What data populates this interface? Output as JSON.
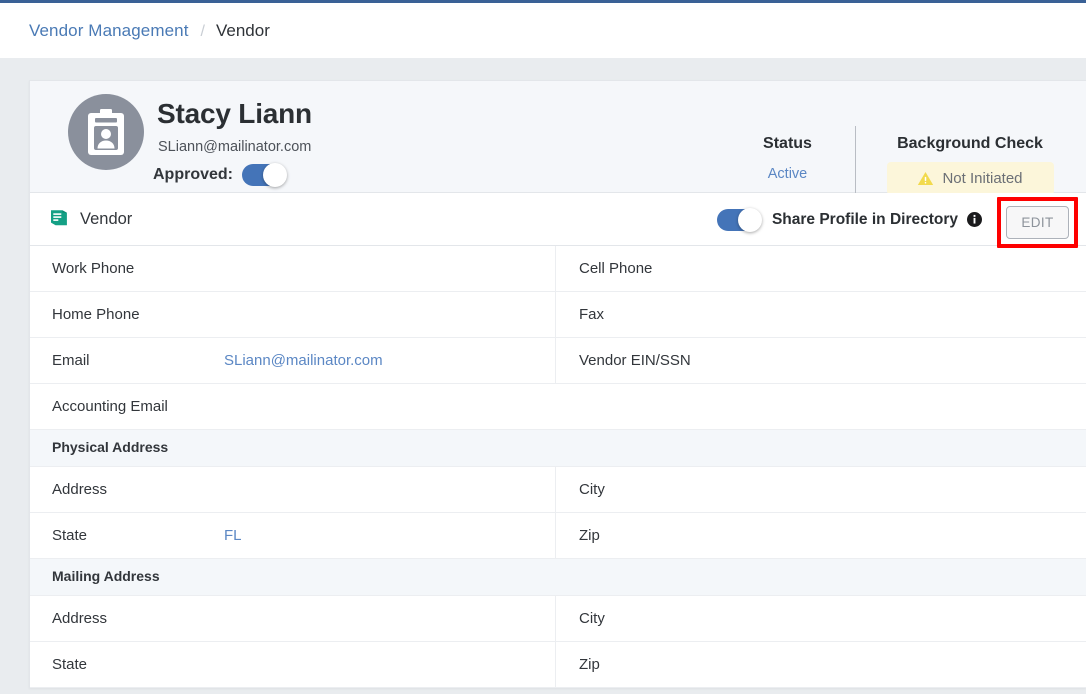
{
  "breadcrumb": {
    "root": "Vendor Management",
    "separator": "/",
    "current": "Vendor"
  },
  "profile": {
    "avatar_icon": "id-badge-icon",
    "name": "Stacy Liann",
    "email": "SLiann@mailinator.com",
    "approved_label": "Approved:",
    "approved_on": true,
    "status_title": "Status",
    "status_value": "Active",
    "background_title": "Background Check",
    "background_badge": "Not Initiated",
    "background_badge_icon": "warning-triangle-icon"
  },
  "tabbar": {
    "tab_icon": "book-icon",
    "tab_label": "Vendor",
    "share_toggle_on": true,
    "share_label": "Share Profile in Directory",
    "share_info_icon": "info-circle-icon",
    "edit_label": "EDIT",
    "edit_highlighted": true
  },
  "details": [
    {
      "kind": "row",
      "left_label": "Work Phone",
      "left_value": "",
      "right_label": "Cell Phone",
      "right_value": "",
      "right_border": true
    },
    {
      "kind": "row",
      "left_label": "Home Phone",
      "left_value": "",
      "right_label": "Fax",
      "right_value": "",
      "right_border": true
    },
    {
      "kind": "row",
      "left_label": "Email",
      "left_value": "SLiann@mailinator.com",
      "right_label": "Vendor EIN/SSN",
      "right_value": "",
      "right_border": true
    },
    {
      "kind": "row",
      "left_label": "Accounting Email",
      "left_value": "",
      "right_label": "",
      "right_value": "",
      "right_border": false
    },
    {
      "kind": "section",
      "title": "Physical Address"
    },
    {
      "kind": "row",
      "left_label": "Address",
      "left_value": "",
      "right_label": "City",
      "right_value": "",
      "right_border": true
    },
    {
      "kind": "row",
      "left_label": "State",
      "left_value": "FL",
      "right_label": "Zip",
      "right_value": "",
      "right_border": true
    },
    {
      "kind": "section",
      "title": "Mailing Address"
    },
    {
      "kind": "row",
      "left_label": "Address",
      "left_value": "",
      "right_label": "City",
      "right_value": "",
      "right_border": true
    },
    {
      "kind": "row",
      "left_label": "State",
      "left_value": "",
      "right_label": "Zip",
      "right_value": "",
      "right_border": true
    }
  ],
  "colors": {
    "top_bar": "#3a6196",
    "link": "#4a7ab5",
    "toggle_on": "#4474b8",
    "tab_icon": "#14a085",
    "badge_bg": "#fcf6da",
    "badge_warning": "#f2da4c",
    "highlight": "#fe0000",
    "page_bg": "#e9ecef"
  }
}
